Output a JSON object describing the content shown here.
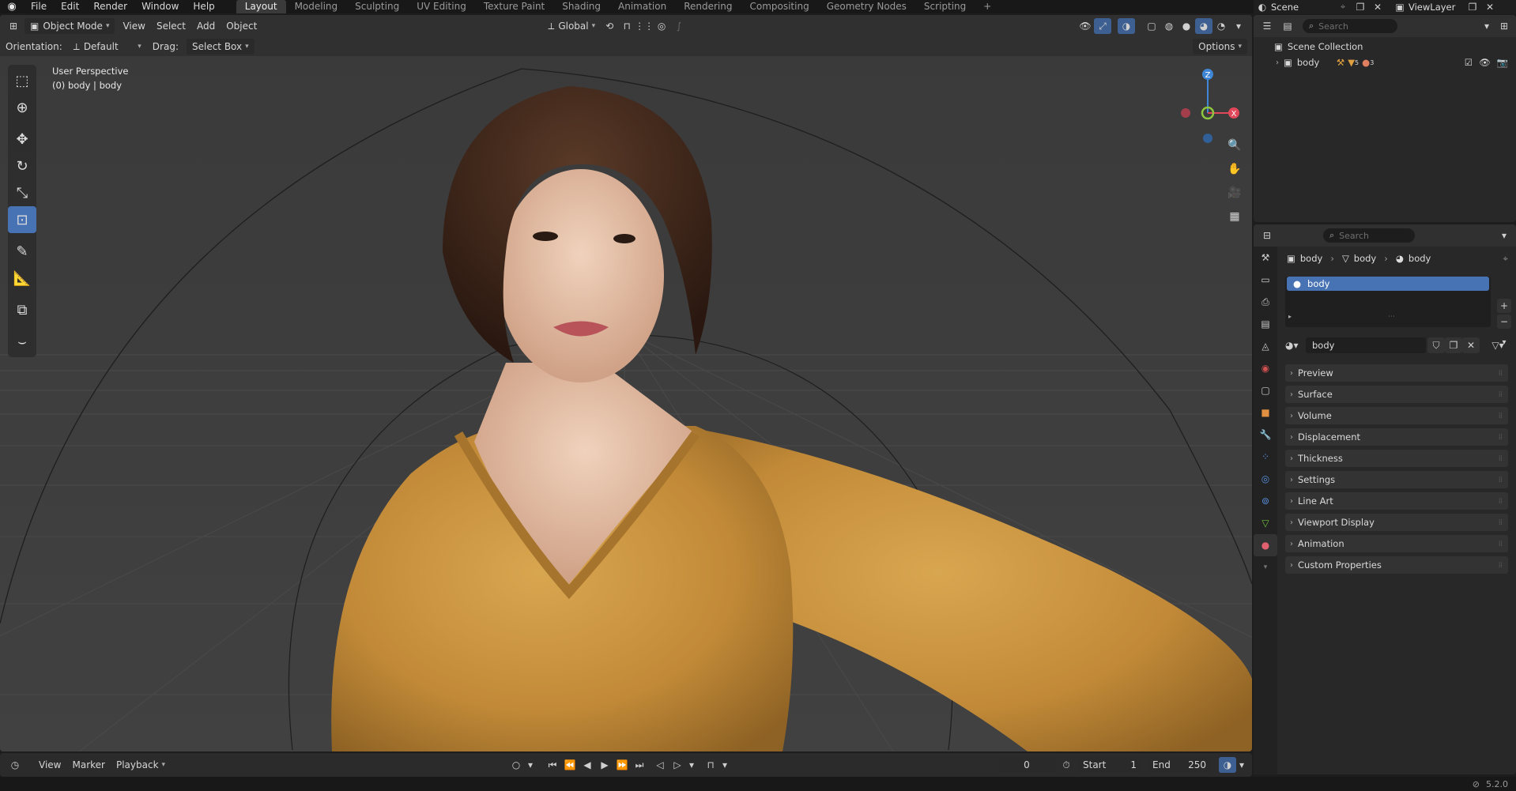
{
  "topbar": {
    "menus": [
      "File",
      "Edit",
      "Render",
      "Window",
      "Help"
    ],
    "workspaces": [
      "Layout",
      "Modeling",
      "Sculpting",
      "UV Editing",
      "Texture Paint",
      "Shading",
      "Animation",
      "Rendering",
      "Compositing",
      "Geometry Nodes",
      "Scripting"
    ],
    "active_workspace": "Layout",
    "scene_label": "Scene",
    "viewlayer_label": "ViewLayer"
  },
  "viewport": {
    "mode_label": "Object Mode",
    "header_menus": [
      "View",
      "Select",
      "Add",
      "Object"
    ],
    "transform_orientation": "Global",
    "orientation_label": "Orientation:",
    "orientation_value": "Default",
    "drag_label": "Drag:",
    "drag_value": "Select Box",
    "options_label": "Options",
    "info_line1": "User Perspective",
    "info_line2": "(0) body | body",
    "gizmo": {
      "z": "Z",
      "x": "X"
    }
  },
  "timeline": {
    "menus": [
      "View",
      "Marker",
      "Playback"
    ],
    "current_frame": "0",
    "start_label": "Start",
    "start_value": "1",
    "end_label": "End",
    "end_value": "250"
  },
  "status": {
    "version": "5.2.0"
  },
  "outliner": {
    "search_placeholder": "Search",
    "collection_label": "Scene Collection",
    "object_label": "body",
    "modifier_count": "5",
    "material_count": "3"
  },
  "properties": {
    "search_placeholder": "Search",
    "crumb_object": "body",
    "crumb_mesh": "body",
    "crumb_material": "body",
    "slot_name": "body",
    "material_name": "body",
    "panels": [
      "Preview",
      "Surface",
      "Volume",
      "Displacement",
      "Thickness",
      "Settings",
      "Line Art",
      "Viewport Display",
      "Animation",
      "Custom Properties"
    ]
  },
  "colors": {
    "accent": "#4772b3",
    "axis_x": "#e0485a",
    "axis_y": "#8ec63f",
    "axis_z": "#3f86d6",
    "sweater": "#c8953f",
    "hair": "#3d261a",
    "skin": "#e6c2a8"
  }
}
